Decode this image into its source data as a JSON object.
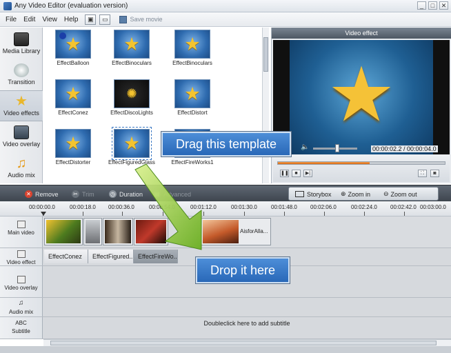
{
  "window": {
    "title": "Any Video Editor (evaluation version)",
    "controls": [
      "_",
      "□",
      "✕"
    ]
  },
  "menu": {
    "items": [
      "File",
      "Edit",
      "View",
      "Help"
    ],
    "save_label": "Save movie"
  },
  "sidebar": {
    "items": [
      {
        "label": "Media Library",
        "icon": "film-icon"
      },
      {
        "label": "Transition",
        "icon": "transition-icon"
      },
      {
        "label": "Video effects",
        "icon": "effects-star-icon"
      },
      {
        "label": "Video overlay",
        "icon": "overlay-icon"
      },
      {
        "label": "Audio mix",
        "icon": "music-note-icon"
      }
    ]
  },
  "effects": [
    {
      "name": "EffectBalloon"
    },
    {
      "name": "EffectBinoculars"
    },
    {
      "name": "EffectBinoculars"
    },
    {
      "name": "EffectConez"
    },
    {
      "name": "EffectDiscoLights"
    },
    {
      "name": "EffectDistort"
    },
    {
      "name": "EffectDistorter"
    },
    {
      "name": "EffectFiguredGlass"
    },
    {
      "name": "EffectFireWorks1"
    }
  ],
  "preview": {
    "header": "Video effect",
    "timecode": "00:00:02.2 / 00:00:04.0",
    "progress": 0.55
  },
  "toolbar": {
    "remove": "Remove",
    "trim": "Trim",
    "duration": "Duration",
    "advanced": "Advanced",
    "storybox": "Storybox",
    "zoom_in": "Zoom in",
    "zoom_out": "Zoom out"
  },
  "ruler": [
    "00:00:00.0",
    "00:00:18.0",
    "00:00:36.0",
    "00:00:54.0",
    "00:01:12.0",
    "00:01:30.0",
    "00:01:48.0",
    "00:02:06.0",
    "00:02:24.0",
    "00:02:42.0",
    "00:03:00.0"
  ],
  "tracks": {
    "main_video": "Main video",
    "video_effect": "Video effect",
    "video_overlay": "Video overlay",
    "audio_mix": "Audio mix",
    "subtitle_icon": "ABC",
    "subtitle": "Subtitle",
    "subtitle_hint": "Doubleclick here to add subtitle",
    "main_clip_label": "AisforAlla...",
    "effect_clips": [
      "EffectConez",
      "EffectFigured...",
      "EffectFireWo..."
    ]
  },
  "callouts": {
    "drag": "Drag this template",
    "drop": "Drop it here"
  },
  "colors": {
    "accent_blue": "#2f74c8",
    "arrow_green": "#8cc63f",
    "progress_orange": "#e07a20",
    "toolbar_dark": "#4a525c"
  }
}
